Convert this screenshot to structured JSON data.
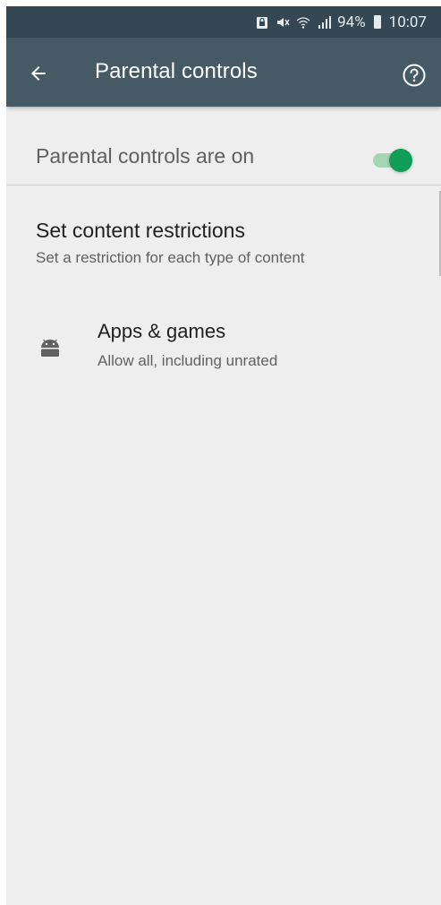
{
  "status_bar": {
    "battery_percent": "94%",
    "time": "10:07",
    "icons": [
      "sim-lock-icon",
      "mute-icon",
      "wifi-icon",
      "signal-icon",
      "battery-icon"
    ]
  },
  "app_bar": {
    "title": "Parental controls",
    "back_icon": "arrow-back-icon",
    "help_icon": "help-circle-icon",
    "background_color": "#455a64"
  },
  "toggle": {
    "label": "Parental controls are on",
    "state": "on",
    "accent_color": "#0f9d58"
  },
  "restrictions": {
    "title": "Set content restrictions",
    "subtitle": "Set a restriction for each type of content",
    "items": [
      {
        "icon": "android-icon",
        "title": "Apps & games",
        "subtitle": "Allow all, including unrated"
      }
    ]
  }
}
